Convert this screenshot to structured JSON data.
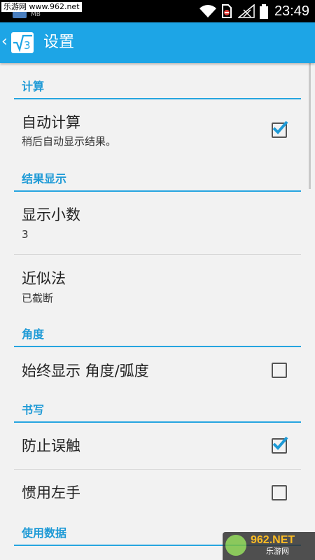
{
  "watermark": {
    "top": "乐游网 www.962.net",
    "bottom_brand": "962.NET",
    "bottom_sub": "乐游网"
  },
  "statusbar": {
    "notification_label": "MB",
    "time": "23:49",
    "icons": [
      "wifi-icon",
      "no-sim-icon",
      "signal-icon",
      "battery-icon"
    ]
  },
  "actionbar": {
    "back_icon": "‹",
    "logo_text": "√3",
    "title": "设置",
    "color": "#1da5e6"
  },
  "sections": [
    {
      "header": "计算",
      "items": [
        {
          "title": "自动计算",
          "summary": "稍后自动显示结果。",
          "checked": true
        }
      ]
    },
    {
      "header": "结果显示",
      "items": [
        {
          "title": "显示小数",
          "summary": "3"
        },
        {
          "title": "近似法",
          "summary": "已截断"
        }
      ]
    },
    {
      "header": "角度",
      "items": [
        {
          "title": "始终显示 角度/弧度",
          "checked": false
        }
      ]
    },
    {
      "header": "书写",
      "items": [
        {
          "title": "防止误触",
          "checked": true
        },
        {
          "title": "惯用左手",
          "checked": false
        }
      ]
    },
    {
      "header": "使用数据",
      "items": []
    }
  ],
  "colors": {
    "accent": "#26a5e0",
    "check": "#1e9ad6",
    "background": "#f2f2f2"
  }
}
